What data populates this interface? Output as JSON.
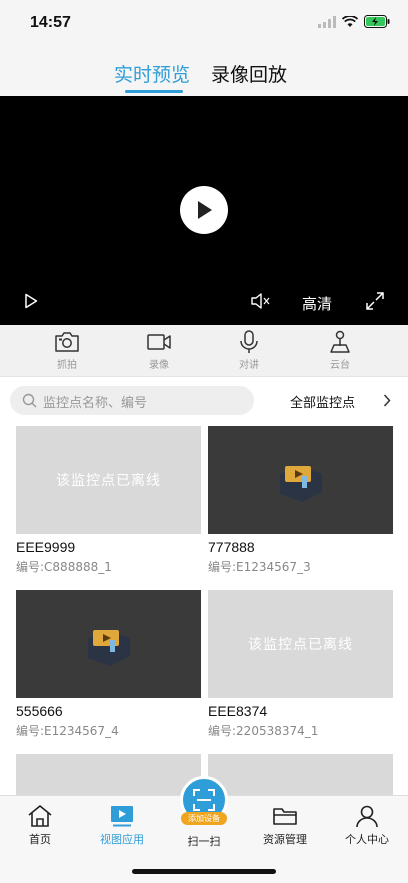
{
  "status": {
    "time": "14:57"
  },
  "tabs": [
    {
      "label": "实时预览",
      "active": true
    },
    {
      "label": "录像回放",
      "active": false
    }
  ],
  "player": {
    "quality_label": "高清"
  },
  "toolbar": [
    {
      "label": "抓拍",
      "icon": "camera-icon"
    },
    {
      "label": "录像",
      "icon": "video-record-icon"
    },
    {
      "label": "对讲",
      "icon": "microphone-icon"
    },
    {
      "label": "云台",
      "icon": "ptz-joystick-icon"
    }
  ],
  "search": {
    "placeholder": "监控点名称、编号",
    "filter_label": "全部监控点"
  },
  "cameras": [
    {
      "name": "EEE9999",
      "id": "编号:C888888_1",
      "status": "offline",
      "overlay": "该监控点已离线"
    },
    {
      "name": "777888",
      "id": "编号:E1234567_3",
      "status": "online"
    },
    {
      "name": "555666",
      "id": "编号:E1234567_4",
      "status": "online"
    },
    {
      "name": "EEE8374",
      "id": "编号:220538374_1",
      "status": "offline",
      "overlay": "该监控点已离线"
    }
  ],
  "nav": [
    {
      "label": "首页",
      "icon": "home-icon",
      "active": false
    },
    {
      "label": "视图应用",
      "icon": "view-app-icon",
      "active": true
    },
    {
      "label": "扫一扫",
      "icon": "scan-icon",
      "active": false,
      "badge": "添加设备"
    },
    {
      "label": "资源管理",
      "icon": "folder-icon",
      "active": false
    },
    {
      "label": "个人中心",
      "icon": "user-icon",
      "active": false
    }
  ],
  "colors": {
    "accent": "#2f9ed8",
    "badge": "#f0a520"
  }
}
